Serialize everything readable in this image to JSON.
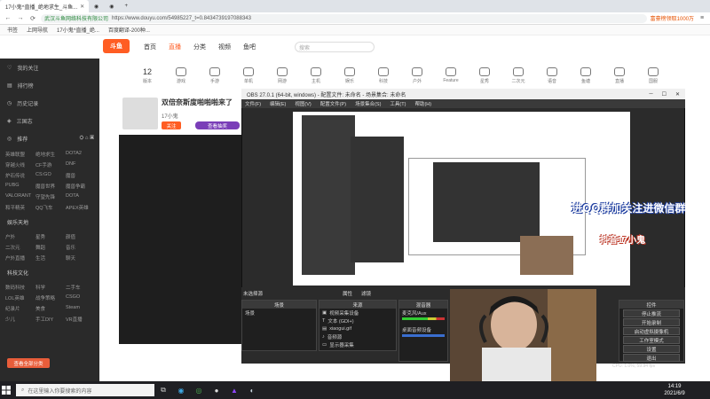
{
  "browser": {
    "tabs": [
      {
        "label": "17小鬼^直播_绝地求生_斗鱼..."
      },
      {
        "label": "0"
      },
      {
        "label": "0"
      },
      {
        "label": "0"
      }
    ],
    "url_org": "武汉斗鱼网络科技有限公司",
    "url": "https://www.douyu.com/54985227_t=0.8434739197088343",
    "bookmarks": [
      "书签",
      "上网导航",
      "17小鬼^直播_绝...",
      "百度翻译-200种..."
    ],
    "right_badge": "富豪榜领取1000万"
  },
  "site": {
    "logo": "斗鱼",
    "nav": [
      "首页",
      "直播",
      "分类",
      "视频",
      "鱼吧"
    ],
    "search_placeholder": "搜索",
    "categories": [
      "12",
      "版本",
      "游戏",
      "手游",
      "单机",
      "网游",
      "主机",
      "娱乐",
      "科技",
      "户外",
      "Feature",
      "星秀",
      "二次元",
      "语音",
      "鱼塘",
      "直播",
      "国服"
    ],
    "sidebar": {
      "rows": [
        "我的关注",
        "排行榜",
        "历史记录",
        "三国志",
        "推荐"
      ],
      "grid1": [
        "英雄联盟",
        "绝地求生",
        "DOTA2",
        "穿越火线",
        "CF手游",
        "DNF",
        "炉石传说",
        "CS:GO",
        "魔兽",
        "PUBG",
        "魔兽世界",
        "魔兽争霸",
        "VALORANT",
        "守望先锋",
        "DOTA",
        "和平精英",
        "QQ飞车",
        "APEX英雄"
      ],
      "head2": "娱乐天地",
      "grid2": [
        "户外",
        "星秀",
        "颜值",
        "二次元",
        "舞蹈",
        "音乐",
        "户外直播",
        "生活",
        "聊天"
      ],
      "head3": "科技文化",
      "grid3": [
        "数码科技",
        "科学",
        "二手车",
        "LOL英雄",
        "战争策略",
        "CSGO",
        "纪录片",
        "美食",
        "Steam",
        "少儿",
        "手工DIY",
        "VR直播"
      ],
      "cta": "查看全部分类"
    },
    "stream": {
      "title": "双倍奈斯度啪啪啪来了",
      "tag": "17小鬼",
      "follow_label": "关注",
      "subscribe_label": "查看抽奖"
    }
  },
  "obs": {
    "title": "OBS 27.0.1 (64-bit, windows) - 配置文件: 未命名 - 场景集合: 未命名",
    "menu": [
      "文件(F)",
      "编辑(E)",
      "视图(V)",
      "配置文件(P)",
      "场景集合(S)",
      "工具(T)",
      "帮助(H)"
    ],
    "preview_label": "未选择源",
    "props_label": "属性",
    "filters_label": "滤镜",
    "scenes_head": "场景",
    "scene_items": [
      "场景"
    ],
    "sources_head": "来源",
    "sources": [
      "视频采集设备",
      "文本 (GDI+)",
      "xiaogui.gif",
      "音频源",
      "显示器采集"
    ],
    "mixer_head": "混音器",
    "mixer_items": [
      "麦克风/Aux",
      "桌面音频设备"
    ],
    "controls_head": "控件",
    "controls": [
      "停止推流",
      "开始录制",
      "启动虚拟摄像机",
      "工作室模式",
      "设置",
      "退出"
    ],
    "status": "CPU: 1.0%, 59.94 fps",
    "overlay1": "进QQ群加关注进微信群",
    "overlay2": "抖音17小鬼"
  },
  "taskbar": {
    "search_placeholder": "在这里输入你要搜索的内容",
    "time": "14:19",
    "date": "2021/6/9"
  }
}
